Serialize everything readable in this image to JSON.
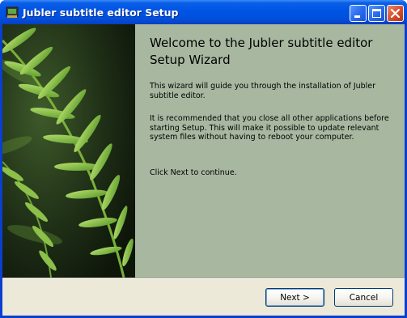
{
  "window": {
    "title": "Jubler subtitle editor Setup",
    "title_bar_color": "#0054e3"
  },
  "icons": {
    "app": "installer-app-icon",
    "minimize": "minimize-icon",
    "maximize": "maximize-icon",
    "close": "close-icon",
    "side_image": "fern-leaf-image"
  },
  "welcome": {
    "heading": "Welcome to the Jubler subtitle editor Setup Wizard",
    "paragraph1": "This wizard will guide you through the installation of Jubler subtitle editor.",
    "paragraph2": "It is recommended that you close all other applications before starting Setup. This will make it possible to update relevant system files without having to reboot your computer.",
    "paragraph3": "Click Next to continue.",
    "pane_color": "#a8b8a0"
  },
  "buttons": {
    "next": "Next >",
    "cancel": "Cancel"
  }
}
